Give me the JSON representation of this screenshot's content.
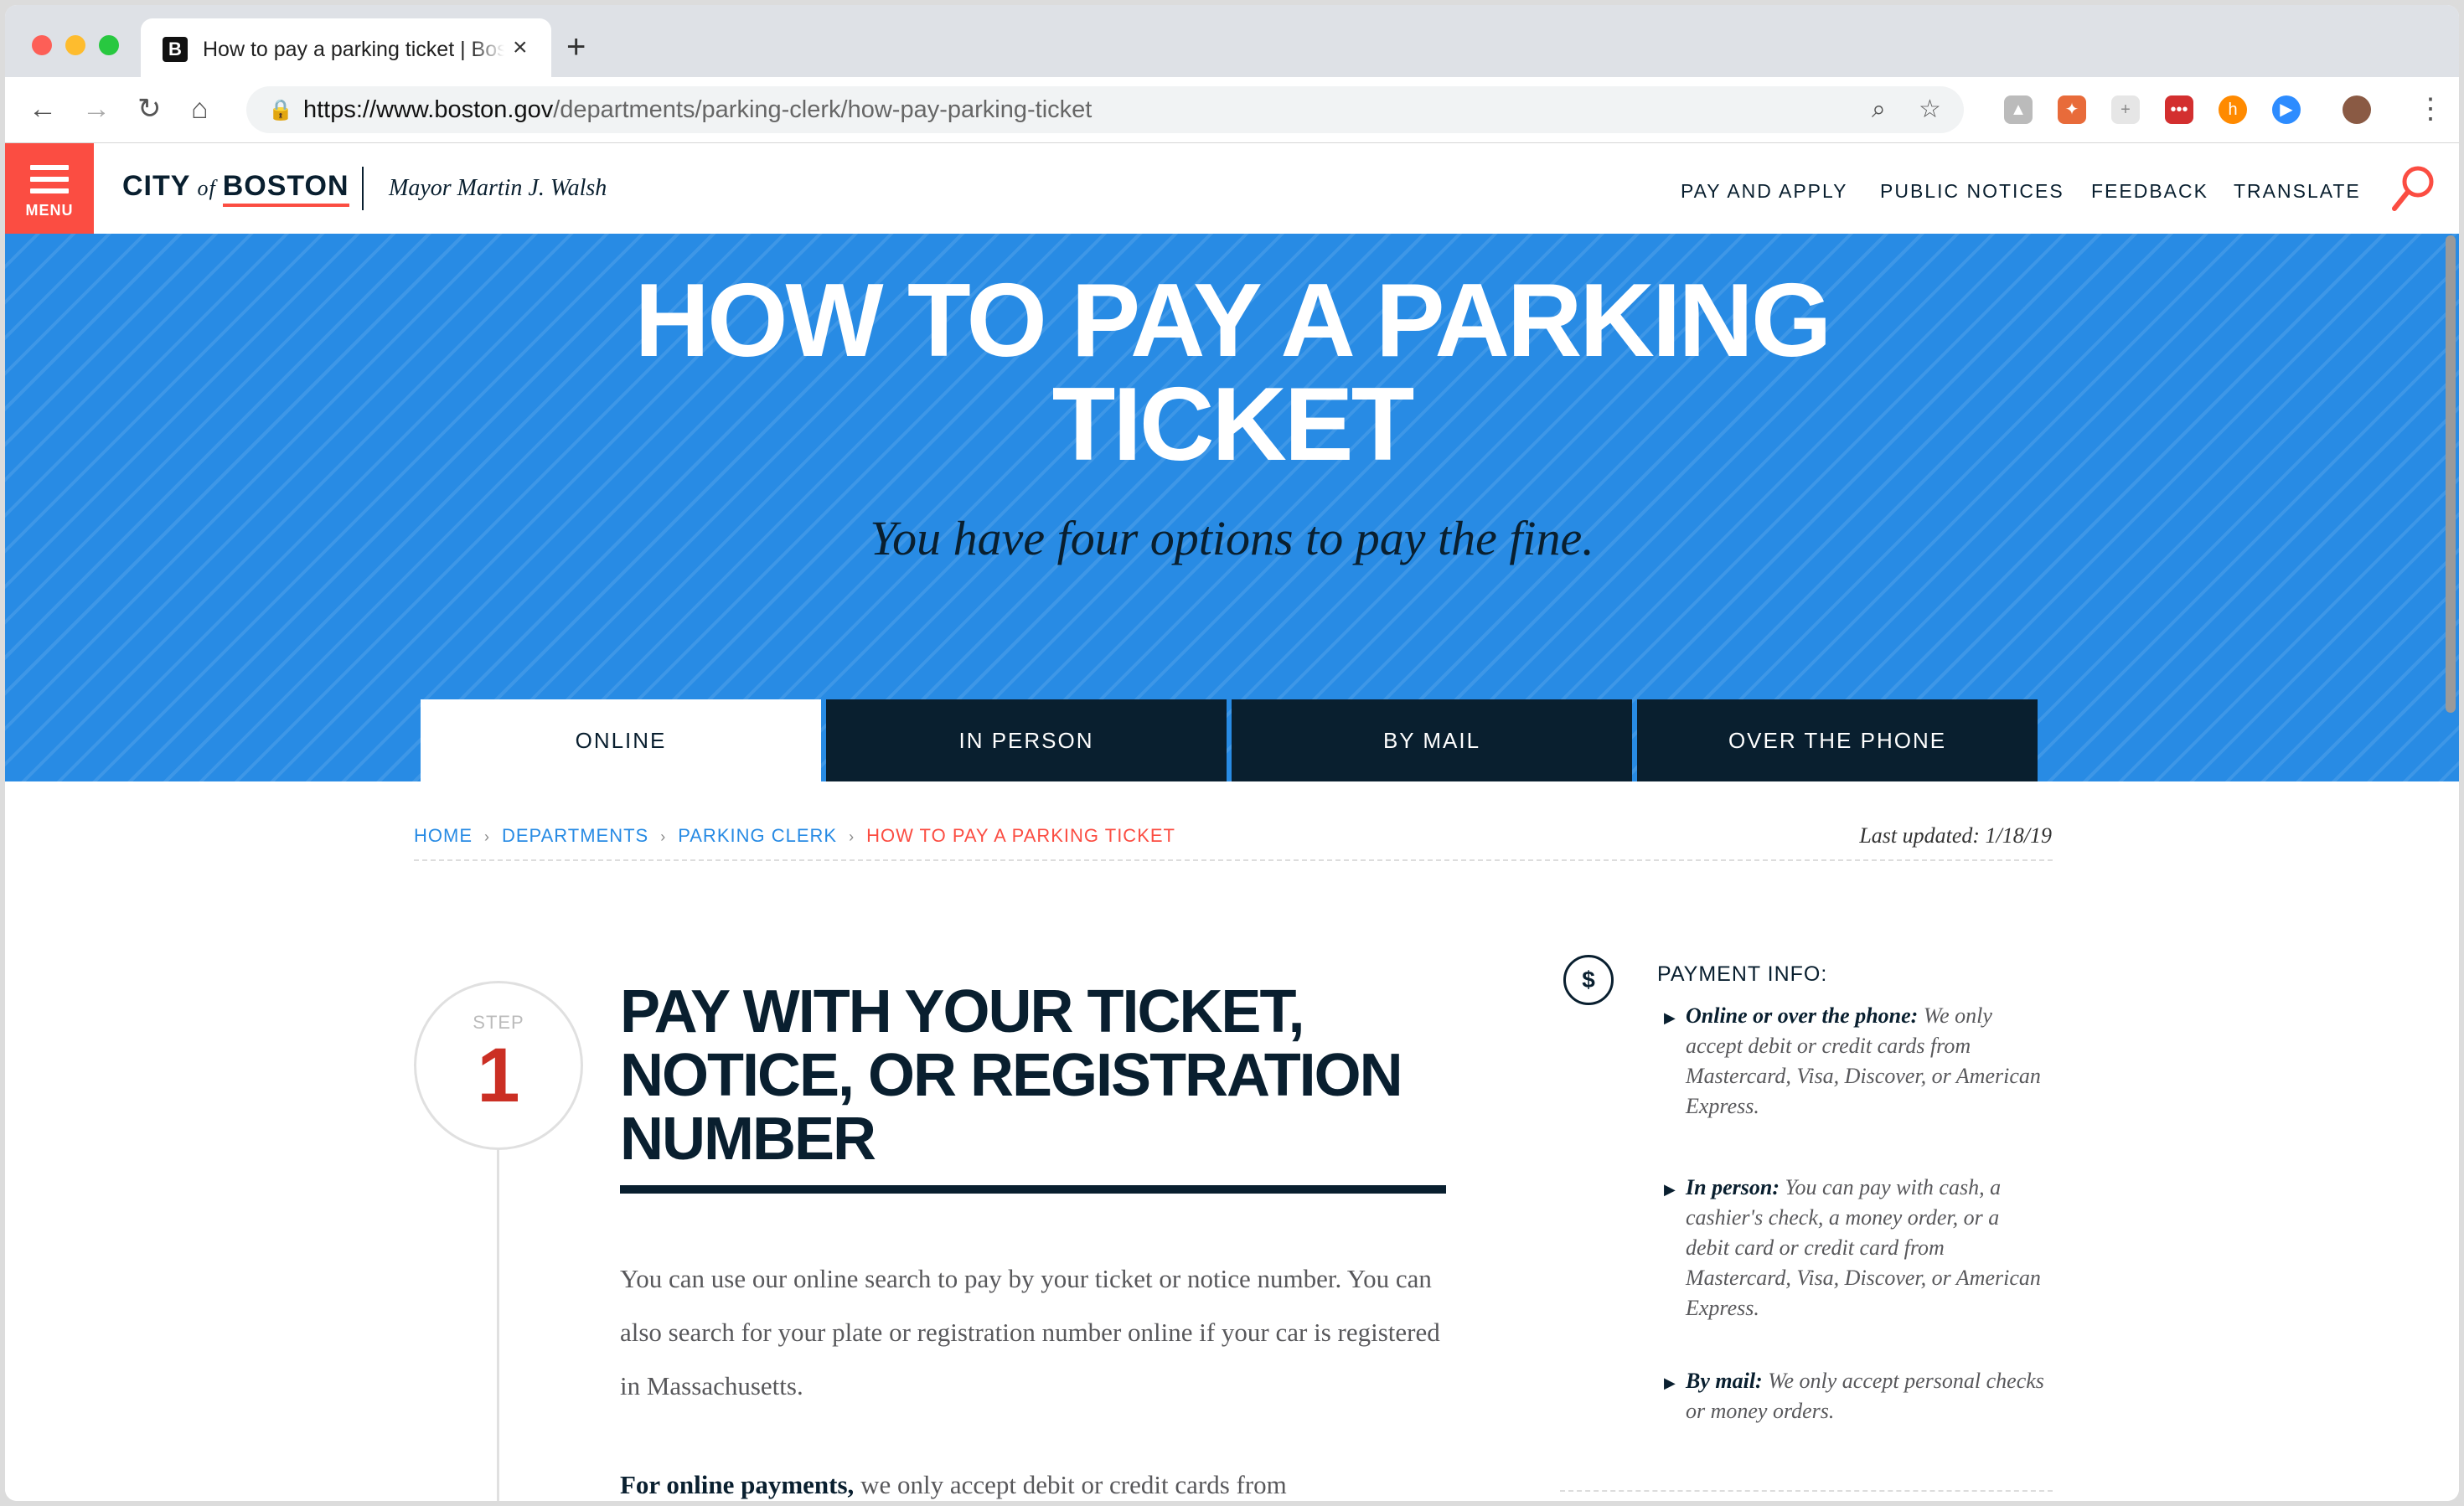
{
  "browser": {
    "tab_title": "How to pay a parking ticket | Boston.gov",
    "tab_favicon": "B",
    "close_glyph": "×",
    "newtab_glyph": "+",
    "url_host": "https://www.boston.gov",
    "url_path": "/departments/parking-clerk/how-pay-parking-ticket"
  },
  "header": {
    "menu_label": "MENU",
    "logo_city": "CITY",
    "logo_of": "of",
    "logo_boston": "BOSTON",
    "mayor": "Mayor Martin J. Walsh",
    "nav": [
      "PAY AND APPLY",
      "PUBLIC NOTICES",
      "FEEDBACK",
      "TRANSLATE"
    ]
  },
  "hero": {
    "title_line1": "HOW TO PAY A PARKING",
    "title_line2": "TICKET",
    "subtitle": "You have four options to pay the fine.",
    "tabs": [
      "ONLINE",
      "IN PERSON",
      "BY MAIL",
      "OVER THE PHONE"
    ],
    "active_tab": "ONLINE"
  },
  "breadcrumb": {
    "items": [
      "HOME",
      "DEPARTMENTS",
      "PARKING CLERK"
    ],
    "current": "HOW TO PAY A PARKING TICKET",
    "separator": "›",
    "last_updated": "Last updated: 1/18/19"
  },
  "step": {
    "label": "STEP",
    "number": "1",
    "title": "PAY WITH YOUR TICKET, NOTICE, OR REGISTRATION NUMBER",
    "body": "You can use our online search to pay by your ticket or notice number. You can also search for your plate or registration number online if your car is registered in Massachusetts.",
    "bottom_bold": "For online payments,",
    "bottom_rest": " we only accept debit or credit cards from"
  },
  "payment_info": {
    "icon_glyph": "$",
    "title": "PAYMENT INFO:",
    "items": [
      {
        "bold": "Online or over the phone:",
        "text": " We only accept debit or credit cards from Mastercard, Visa, Discover, or American Express."
      },
      {
        "bold": "In person:",
        "text": " You can pay with cash, a cashier's check, a money order, or a debit card or credit card from Mastercard, Visa, Discover, or American Express."
      },
      {
        "bold": "By mail:",
        "text": " We only accept personal checks or money orders."
      }
    ]
  },
  "colors": {
    "hero_blue": "#288be4",
    "navy": "#091f2f",
    "accent_red": "#fb4d42",
    "step_red": "#cb2f24"
  }
}
